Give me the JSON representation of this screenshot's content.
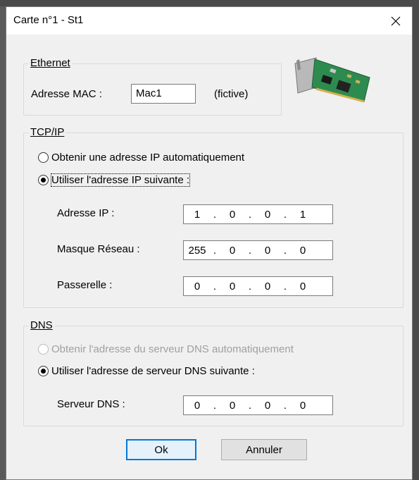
{
  "window": {
    "title": "Carte n°1 - St1"
  },
  "ethernet": {
    "legend": "Ethernet",
    "mac_label": "Adresse MAC :",
    "mac_value": "Mac1",
    "mac_note": "(fictive)"
  },
  "tcpip": {
    "legend": "TCP/IP",
    "radio_auto": "Obtenir une adresse IP automatiquement",
    "radio_manual": "Utiliser l'adresse IP suivante :",
    "selected": "manual",
    "ip_label": "Adresse IP :",
    "ip": [
      "1",
      "0",
      "0",
      "1"
    ],
    "mask_label": "Masque Réseau :",
    "mask": [
      "255",
      "0",
      "0",
      "0"
    ],
    "gateway_label": "Passerelle :",
    "gateway": [
      "0",
      "0",
      "0",
      "0"
    ]
  },
  "dns": {
    "legend": "DNS",
    "radio_auto": "Obtenir l'adresse du serveur DNS automatiquement",
    "radio_manual": "Utiliser l'adresse de serveur DNS suivante :",
    "selected": "manual",
    "server_label": "Serveur DNS :",
    "server": [
      "0",
      "0",
      "0",
      "0"
    ]
  },
  "buttons": {
    "ok": "Ok",
    "cancel": "Annuler"
  },
  "icons": {
    "close": "close-icon",
    "network_card": "network-card-icon"
  },
  "colors": {
    "accent": "#0078d7",
    "window_bg": "#f0f0f0",
    "disabled_text": "#a0a0a0"
  }
}
